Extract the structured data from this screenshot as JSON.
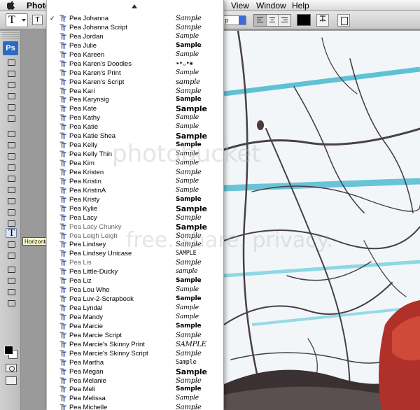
{
  "menubar": {
    "app_label": "Photo",
    "view_label": "View",
    "window_label": "Window",
    "help_label": "Help"
  },
  "options_bar": {
    "tool_glyph": "T",
    "orientation_glyph": "T",
    "antialias_value": "p",
    "text_color": "#000000"
  },
  "tools": {
    "logo": "Ps",
    "text_tool_glyph": "T",
    "tooltip": "Horizontal Ty"
  },
  "font_list": {
    "checked_index": 0,
    "fonts": [
      {
        "name": "Pea Johanna",
        "sample": "Sample",
        "style": "script"
      },
      {
        "name": "Pea Johanna Script",
        "sample": "Sample",
        "style": "script"
      },
      {
        "name": "Pea Jordan",
        "sample": "Sample",
        "style": "normal"
      },
      {
        "name": "Pea Julie",
        "sample": "Sample",
        "style": "bold"
      },
      {
        "name": "Pea Kareen",
        "sample": "Sample",
        "style": "normal"
      },
      {
        "name": "Pea Karen's Doodles",
        "sample": "❧•◡•❀",
        "style": "mono"
      },
      {
        "name": "Pea Karen's Print",
        "sample": "Sample",
        "style": "normal"
      },
      {
        "name": "Pea Karen's Script",
        "sample": "sample",
        "style": "script"
      },
      {
        "name": "Pea Kari",
        "sample": "Sample",
        "style": "script"
      },
      {
        "name": "Pea Karynsig",
        "sample": "Sample",
        "style": "bold"
      },
      {
        "name": "Pea Kate",
        "sample": "Sample",
        "style": "big"
      },
      {
        "name": "Pea Kathy",
        "sample": "Sample",
        "style": "normal"
      },
      {
        "name": "Pea Katie",
        "sample": "Sample",
        "style": "normal"
      },
      {
        "name": "Pea Katie Shea",
        "sample": "Sample",
        "style": "big"
      },
      {
        "name": "Pea Kelly",
        "sample": "Sample",
        "style": "bold"
      },
      {
        "name": "Pea Kelly Thin",
        "sample": "Sample",
        "style": "normal"
      },
      {
        "name": "Pea Kim",
        "sample": "Sample",
        "style": "normal"
      },
      {
        "name": "Pea Kristen",
        "sample": "Sample",
        "style": "script"
      },
      {
        "name": "Pea Kristin",
        "sample": "Sample",
        "style": "normal"
      },
      {
        "name": "Pea KristinA",
        "sample": "Sample",
        "style": "normal"
      },
      {
        "name": "Pea Kristy",
        "sample": "Sample",
        "style": "bold"
      },
      {
        "name": "Pea Kylie",
        "sample": "Sample",
        "style": "big"
      },
      {
        "name": "Pea Lacy",
        "sample": "Sample",
        "style": "script"
      },
      {
        "name": "Pea Lacy Chunky",
        "sample": "Sample",
        "style": "big",
        "grey": true
      },
      {
        "name": "Pea Leigh Leigh",
        "sample": "Sample",
        "style": "script",
        "grey": true
      },
      {
        "name": "Pea Lindsey",
        "sample": "Sample",
        "style": "script"
      },
      {
        "name": "Pea Lindsey Unicase",
        "sample": "SAMPLE",
        "style": "mono"
      },
      {
        "name": "Pea Lis",
        "sample": "Sample",
        "style": "script",
        "grey": true
      },
      {
        "name": "Pea Little-Ducky",
        "sample": "sample",
        "style": "normal"
      },
      {
        "name": "Pea Liz",
        "sample": "Sample",
        "style": "bold"
      },
      {
        "name": "Pea Lou Who",
        "sample": "Sample",
        "style": "normal"
      },
      {
        "name": "Pea Luv-2-Scrapbook",
        "sample": "Sample",
        "style": "bold"
      },
      {
        "name": "Pea Lyndal",
        "sample": "Sample",
        "style": "normal"
      },
      {
        "name": "Pea Mandy",
        "sample": "Sample",
        "style": "normal"
      },
      {
        "name": "Pea Marcie",
        "sample": "Sample",
        "style": "bold"
      },
      {
        "name": "Pea Marcie Script",
        "sample": "Sample",
        "style": "script"
      },
      {
        "name": "Pea Marcie's Skinny Print",
        "sample": "SAMPLE",
        "style": "script"
      },
      {
        "name": "Pea Marcie's Skinny Script",
        "sample": "Sample",
        "style": "script"
      },
      {
        "name": "Pea Martha",
        "sample": "Sample",
        "style": "mono"
      },
      {
        "name": "Pea Megan",
        "sample": "Sample",
        "style": "big"
      },
      {
        "name": "Pea Melanie",
        "sample": "Sample",
        "style": "script"
      },
      {
        "name": "Pea Meli",
        "sample": "Sample",
        "style": "bold"
      },
      {
        "name": "Pea Melissa",
        "sample": "Sample",
        "style": "normal"
      },
      {
        "name": "Pea Michelle",
        "sample": "Sample",
        "style": "script"
      }
    ]
  },
  "watermark": {
    "line1": "photobucket",
    "line2": "free. share. privacy."
  }
}
